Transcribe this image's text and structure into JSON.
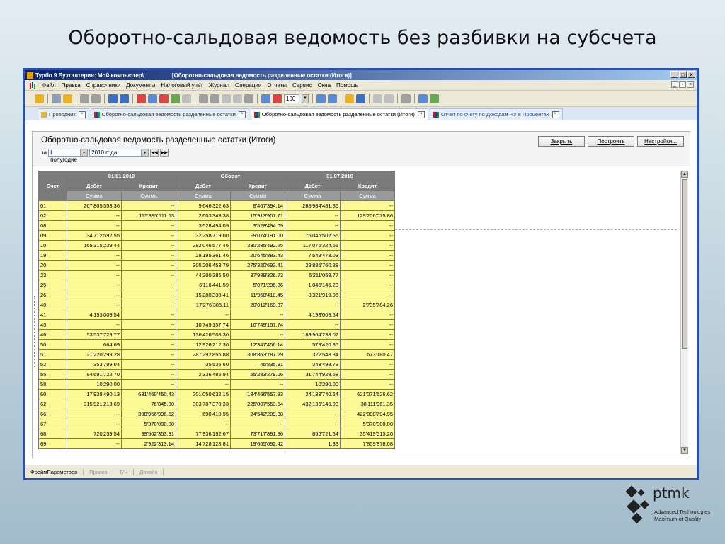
{
  "slide_title": "Оборотно-сальдовая ведомость без разбивки на субсчета",
  "window": {
    "app_name": "Турбо 9 Бухгалтерия: Мой компьютер\\",
    "doc_title": "[Оборотно-сальдовая ведомость разделенные остатки (Итоги)]"
  },
  "menu": [
    "Файл",
    "Правка",
    "Справочники",
    "Документы",
    "Налоговый учет",
    "Журнал",
    "Операции",
    "Отчеты",
    "Сервис",
    "Окна",
    "Помощь"
  ],
  "toolbar": {
    "zoom": "100"
  },
  "tabs": [
    {
      "label": "Проводник"
    },
    {
      "label": "Оборотно-сальдовая ведомость разделенные остатки"
    },
    {
      "label": "Оборотно-сальдовая ведомость разделенные остатки (Итоги)"
    },
    {
      "label": "Отчет по счету по Доходам НУ в Процентах"
    }
  ],
  "report": {
    "title": "Оборотно-сальдовая ведомость разделенные остатки (Итоги)",
    "for_label": "за",
    "period": "I полугодие",
    "year": "2010 года",
    "buttons": {
      "close": "Закрыть",
      "build": "Построить",
      "settings": "Настройки..."
    }
  },
  "table": {
    "h_account": "Счет",
    "h_groups": [
      "01.01.2010",
      "Оборот",
      "01.07.2010"
    ],
    "h_debit": "Дебет",
    "h_credit": "Кредит",
    "h_sum": "Сумма",
    "rows": [
      [
        "01",
        "267'805'553.36",
        "--",
        "9'646'322.63",
        "8'467'394.14",
        "268'984'481.85",
        "--"
      ],
      [
        "02",
        "--",
        "115'895'511.53",
        "2'603'343.38",
        "15'913'907.71",
        "--",
        "129'206'075.86"
      ],
      [
        "08",
        "--",
        "--",
        "3'528'494.09",
        "3'528'494.09",
        "--",
        "--"
      ],
      [
        "09",
        "34'712'592.55",
        "--",
        "32'258'719.00",
        "-9'074'191.00",
        "76'045'502.55",
        "--"
      ],
      [
        "10",
        "165'315'239.44",
        "--",
        "282'046'577.46",
        "330'285'492.25",
        "117'076'324.65",
        "--"
      ],
      [
        "19",
        "--",
        "--",
        "28'195'361.46",
        "20'645'883.43",
        "7'549'478.03",
        "--"
      ],
      [
        "20",
        "--",
        "--",
        "305'206'453.79",
        "275'320'693.41",
        "29'885'760.38",
        "--"
      ],
      [
        "23",
        "--",
        "--",
        "44'200'386.50",
        "37'989'326.73",
        "6'211'059.77",
        "--"
      ],
      [
        "25",
        "--",
        "--",
        "6'116'441.59",
        "5'071'296.36",
        "1'045'145.23",
        "--"
      ],
      [
        "26",
        "--",
        "--",
        "15'280'338.41",
        "11'958'418.45",
        "3'321'919.96",
        "--"
      ],
      [
        "40",
        "--",
        "--",
        "17'276'385.11",
        "20'012'169.37",
        "--",
        "2'735'784.26"
      ],
      [
        "41",
        "4'193'009.54",
        "--",
        "--",
        "--",
        "4'193'009.54",
        "--"
      ],
      [
        "43",
        "--",
        "--",
        "10'749'157.74",
        "10'749'157.74",
        "--",
        "--"
      ],
      [
        "46",
        "53'537'729.77",
        "--",
        "136'426'508.30",
        "--",
        "189'964'238.07",
        "--"
      ],
      [
        "50",
        "664.69",
        "--",
        "12'926'212.30",
        "12'347'456.14",
        "579'420.85",
        "--"
      ],
      [
        "51",
        "21'220'299.28",
        "--",
        "287'292'855.88",
        "308'863'787.29",
        "322'548.34",
        "673'180.47"
      ],
      [
        "52",
        "353'799.04",
        "--",
        "35'535.60",
        "45'835.91",
        "343'498.73",
        "--"
      ],
      [
        "55",
        "84'691'722.70",
        "--",
        "2'336'485.94",
        "55'283'279.06",
        "31'744'929.58",
        "--"
      ],
      [
        "58",
        "10'290.00",
        "--",
        "--",
        "--",
        "10'290.00",
        "--"
      ],
      [
        "60",
        "17'938'490.13",
        "631'460'450.43",
        "201'050'632.15",
        "184'466'557.83",
        "24'133'740.64",
        "621'071'626.62"
      ],
      [
        "62",
        "315'921'213.69",
        "76'845.80",
        "303'787'370.33",
        "225'807'553.54",
        "432'136'146.03",
        "38'111'961.35"
      ],
      [
        "66",
        "--",
        "398'956'996.52",
        "690'410.95",
        "24'542'209.38",
        "--",
        "422'808'794.95"
      ],
      [
        "67",
        "--",
        "5'370'000.00",
        "--",
        "--",
        "--",
        "5'370'000.00"
      ],
      [
        "68",
        "720'259.54",
        "39'502'353.91",
        "77'936'192.67",
        "73'717'891.96",
        "855'721.54",
        "35'419'515.20"
      ],
      [
        "69",
        "--",
        "2'922'313.14",
        "14'728'128.81",
        "19'665'692.42",
        "1.33",
        "7'859'878.08"
      ]
    ]
  },
  "statusbar": [
    "ФреймПараметров",
    "Правка",
    "Т/Ч",
    "Дизайн"
  ],
  "logo": {
    "name": "ptmk",
    "tagline1": "Advanced Technologies",
    "tagline2": "Maximum of Quality"
  }
}
